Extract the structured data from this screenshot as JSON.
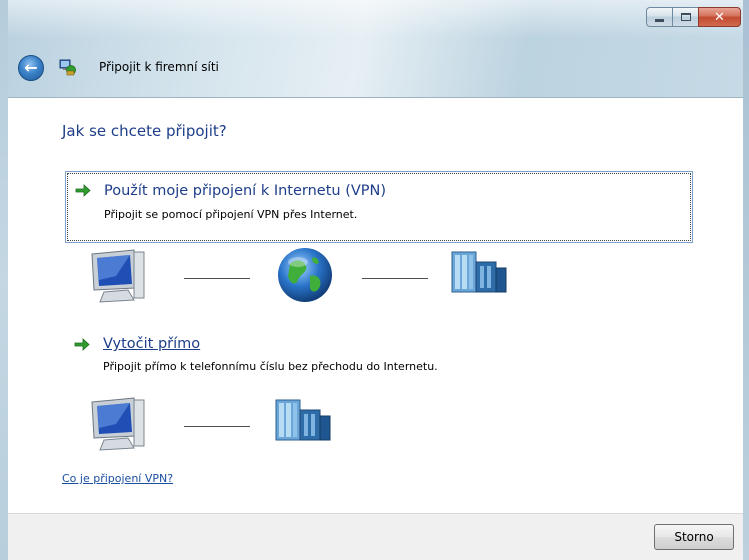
{
  "window": {
    "title": "Připojit k firemní síti",
    "caption_buttons": [
      {
        "name": "minimize",
        "icon": "minimize-icon"
      },
      {
        "name": "maximize",
        "icon": "maximize-icon"
      },
      {
        "name": "close",
        "icon": "close-icon",
        "glyph": "✕"
      }
    ]
  },
  "nav": {
    "back_icon": "back-arrow-icon",
    "back_glyph": "←"
  },
  "main": {
    "heading": "Jak se chcete připojit?",
    "options": [
      {
        "title": "Použít moje připojení k Internetu (VPN)",
        "description": "Připojit se pomocí připojení VPN přes Internet.",
        "selected": true,
        "diagram": [
          "computer-icon",
          "globe-icon",
          "server-icon"
        ]
      },
      {
        "title": "Vytočit přímo",
        "description": "Připojit přímo k telefonnímu číslu bez přechodu do Internetu.",
        "selected": false,
        "diagram": [
          "computer-icon",
          "server-icon"
        ]
      }
    ],
    "help_link": "Co je připojení VPN?"
  },
  "footer": {
    "cancel_label": "Storno"
  },
  "colors": {
    "heading": "#1e3e8a",
    "link": "#1a4fa0",
    "arrow_green": "#2f9e2f",
    "frame": "#c4d7e3"
  }
}
